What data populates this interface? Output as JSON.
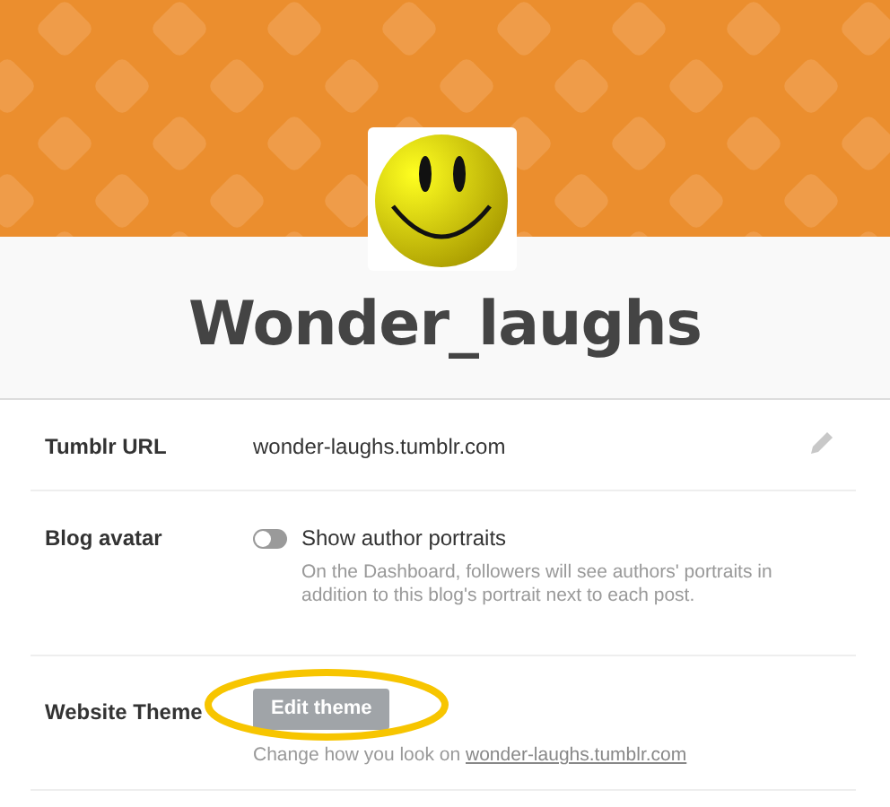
{
  "blog": {
    "title": "Wonder_laughs"
  },
  "settings": [
    {
      "kind": "url",
      "label": "Tumblr URL",
      "value": "wonder-laughs.tumblr.com"
    },
    {
      "kind": "toggle",
      "label": "Blog avatar",
      "option": "Show author portraits",
      "on": false,
      "description": "On the Dashboard, followers will see authors' portraits in addition to this blog's portrait next to each post."
    },
    {
      "kind": "theme",
      "label": "Website Theme",
      "button": "Edit theme",
      "hint": "Change how you look on",
      "link": "wonder-laughs.tumblr.com"
    }
  ]
}
